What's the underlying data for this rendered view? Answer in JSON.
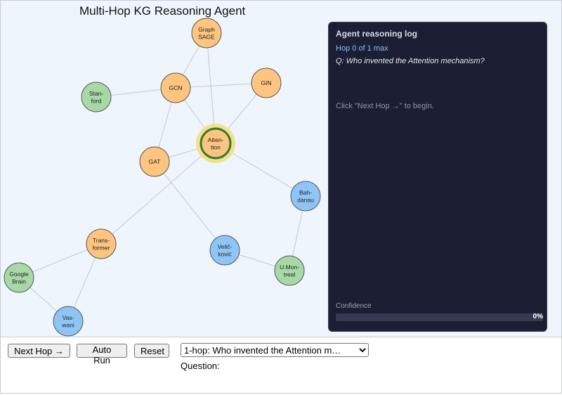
{
  "title": "Multi-Hop KG Reasoning Agent",
  "panel": {
    "title": "Agent reasoning log",
    "hop_status": "Hop 0 of 1 max",
    "question": "Q: Who invented the Attention mechanism?",
    "hint": "Click \"Next Hop →\" to begin.",
    "confidence_label": "Confidence",
    "confidence_value": "0%",
    "confidence_fraction": 0
  },
  "controls": {
    "next_hop": "Next Hop →",
    "auto_run": "Auto Run",
    "reset": "Reset",
    "question_label": "Question:",
    "selected_question": "1-hop: Who invented the Attention m…"
  },
  "colors": {
    "method_node": "#fdc57f",
    "person_node": "#8ec5f4",
    "org_node": "#a8d8a8",
    "node_stroke": "#555555",
    "edge": "#c4c9cf",
    "active_ring": "#2e7d32",
    "active_halo": "#f5df8a"
  },
  "graph": {
    "nodes": [
      {
        "id": "graphsage",
        "lines": [
          "Graph",
          "SAGE"
        ],
        "kind": "method"
      },
      {
        "id": "gcn",
        "lines": [
          "GCN"
        ],
        "kind": "method"
      },
      {
        "id": "gin",
        "lines": [
          "GIN"
        ],
        "kind": "method"
      },
      {
        "id": "stanford",
        "lines": [
          "Stan-",
          "ford"
        ],
        "kind": "org"
      },
      {
        "id": "attention",
        "lines": [
          "Atten-",
          "tion"
        ],
        "kind": "method",
        "active": true
      },
      {
        "id": "gat",
        "lines": [
          "GAT"
        ],
        "kind": "method"
      },
      {
        "id": "bahdanau",
        "lines": [
          "Bah-",
          "danau"
        ],
        "kind": "person"
      },
      {
        "id": "transformer",
        "lines": [
          "Trans-",
          "former"
        ],
        "kind": "method"
      },
      {
        "id": "velickovic",
        "lines": [
          "Velič-",
          "ković"
        ],
        "kind": "person"
      },
      {
        "id": "umontreal",
        "lines": [
          "U.Mon-",
          "treal"
        ],
        "kind": "org"
      },
      {
        "id": "googlebrain",
        "lines": [
          "Google",
          "Brain"
        ],
        "kind": "org"
      },
      {
        "id": "vaswani",
        "lines": [
          "Vas-",
          "wani"
        ],
        "kind": "person"
      }
    ],
    "edges": [
      [
        "graphsage",
        "gcn"
      ],
      [
        "graphsage",
        "attention"
      ],
      [
        "stanford",
        "gcn"
      ],
      [
        "gcn",
        "gin"
      ],
      [
        "gcn",
        "gat"
      ],
      [
        "gcn",
        "attention"
      ],
      [
        "gin",
        "attention"
      ],
      [
        "gat",
        "attention"
      ],
      [
        "attention",
        "bahdanau"
      ],
      [
        "attention",
        "transformer"
      ],
      [
        "gat",
        "velickovic"
      ],
      [
        "velickovic",
        "umontreal"
      ],
      [
        "bahdanau",
        "umontreal"
      ],
      [
        "transformer",
        "googlebrain"
      ],
      [
        "transformer",
        "vaswani"
      ],
      [
        "googlebrain",
        "vaswani"
      ]
    ]
  }
}
